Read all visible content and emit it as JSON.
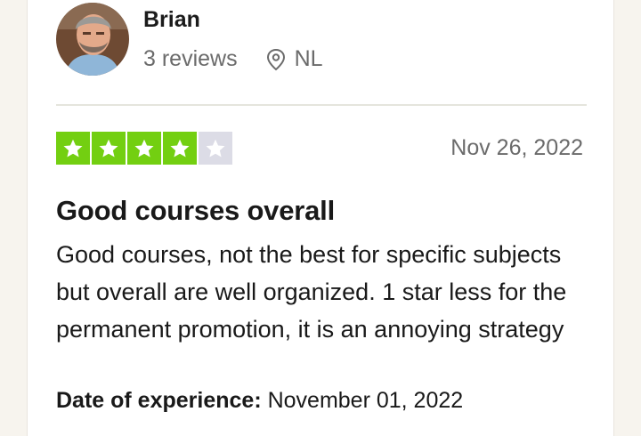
{
  "reviewer": {
    "name": "Brian",
    "review_count": "3 reviews",
    "location": "NL",
    "avatar_icon": "user-photo",
    "location_icon": "map-pin-icon"
  },
  "review": {
    "rating": 4,
    "rating_max": 5,
    "star_color": "#73cf11",
    "empty_star_color": "#dcdce6",
    "date": "Nov 26, 2022",
    "title": "Good courses overall",
    "body": "Good courses, not the best for specific subjects but overall are well organized. 1 star less for the permanent promotion, it is an annoying strategy",
    "experience_label": "Date of experience:",
    "experience_date": "November 01, 2022"
  }
}
